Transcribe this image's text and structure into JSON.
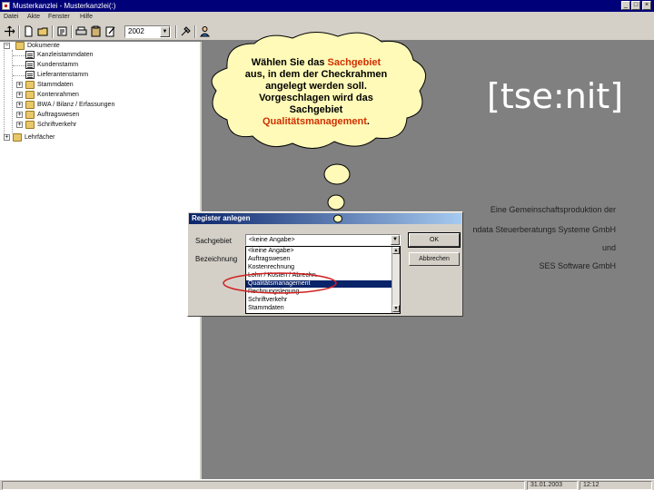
{
  "window": {
    "title": "Musterkanzlei - Musterkanzlei(:)",
    "controls": {
      "minimize": "_",
      "maximize": "□",
      "close": "×"
    }
  },
  "menu": [
    "Datei",
    "Akte",
    "Fenster",
    "Hilfe"
  ],
  "toolbar": {
    "year": "2002",
    "combo_arrow": "▼"
  },
  "tree": {
    "root": "Dokumente",
    "children": [
      {
        "label": "Kanzleistammdaten",
        "icon": "doc-icon"
      },
      {
        "label": "Kundenstamm",
        "icon": "doc-icon"
      },
      {
        "label": "Lieferantenstamm",
        "icon": "doc-icon"
      },
      {
        "label": "Stammdaten",
        "icon": "folder-icon"
      },
      {
        "label": "Kontenrahmen",
        "icon": "folder-icon"
      },
      {
        "label": "BWA / Bilanz / Erfassungen",
        "icon": "folder-icon"
      },
      {
        "label": "Auftragswesen",
        "icon": "folder-icon"
      },
      {
        "label": "Schriftverkehr",
        "icon": "folder-icon"
      }
    ],
    "second_root": "Lehrfächer",
    "expand": "+",
    "collapse": "−"
  },
  "bubble": {
    "line1_pre": "Wählen Sie das ",
    "line1_hl": "Sachgebiet",
    "line2": "aus, in dem der Checkrahmen",
    "line3": "angelegt werden soll.",
    "line4": "Vorgeschlagen wird das",
    "line5": "Sachgebiet",
    "line6_hl": "Qualitätsmanagement",
    "line6_post": "."
  },
  "brand": "[tse:nit]",
  "credits": [
    "Eine Gemeinschaftsproduktion der",
    "ndata Steuerberatungs Systeme GmbH",
    "und",
    "SES Software GmbH"
  ],
  "dialog": {
    "title": "Register anlegen",
    "field_sachgebiet": "Sachgebiet",
    "field_bezeichnung": "Bezeichnung",
    "combo_value": "<keine Angabe>",
    "combo_arrow": "▼",
    "scroll_up": "▲",
    "scroll_down": "▼",
    "options": [
      "<keine Angabe>",
      "Auftragswesen",
      "Kostenrechnung",
      "Lohn / Kosten / Abrechn.",
      "Qualitätsmanagement",
      "Rechnungslegung",
      "Schriftverkehr",
      "Stammdaten"
    ],
    "selected_index": 4,
    "ok": "OK",
    "cancel": "Abbrechen"
  },
  "status": {
    "date": "31.01.2003",
    "time": "12:12"
  },
  "colors": {
    "titlebar": "#000078",
    "highlight_text": "#d03000",
    "ellipse": "#d02020",
    "bubble": "#fffab8",
    "selection": "#0a246a"
  }
}
